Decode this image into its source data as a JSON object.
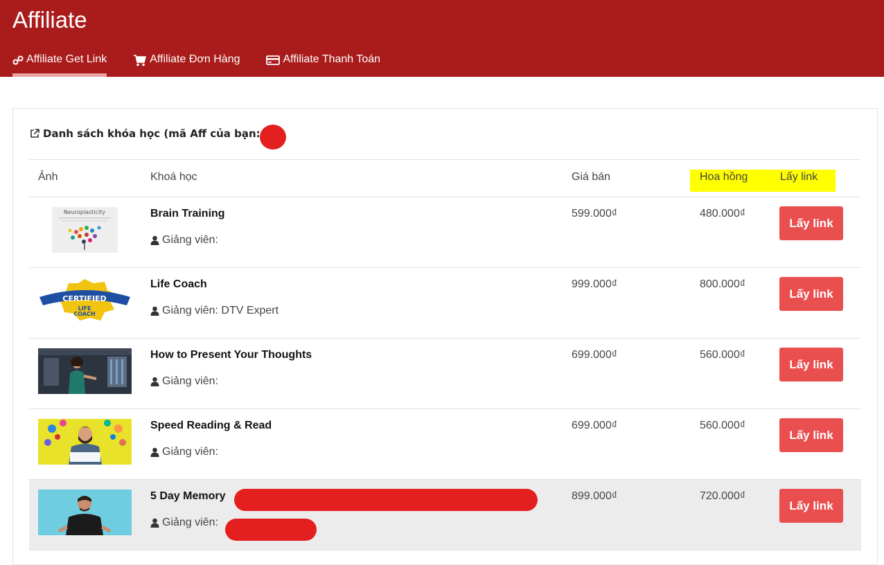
{
  "header": {
    "title": "Affiliate",
    "tabs": [
      {
        "label": "Affiliate Get Link",
        "icon": "link-icon",
        "active": true
      },
      {
        "label": "Affiliate Đơn Hàng",
        "icon": "cart-icon",
        "active": false
      },
      {
        "label": "Affiliate Thanh Toán",
        "icon": "credit-card-icon",
        "active": false
      }
    ]
  },
  "panel": {
    "heading": "Danh sách khóa học  (mã Aff của bạn:"
  },
  "table": {
    "columns": {
      "image": "Ảnh",
      "course": "Khoá học",
      "price": "Giá bán",
      "commission": "Hoa hồng",
      "get_link": "Lấy link"
    },
    "rows": [
      {
        "name": "Brain Training",
        "teacher": "Giảng viên:",
        "price": "599.000₫",
        "commission": "480.000₫",
        "button": "Lấy link",
        "thumb": "Neuroplasticity"
      },
      {
        "name": "Life Coach",
        "teacher": "Giảng viên: DTV Expert",
        "price": "999.000₫",
        "commission": "800.000₫",
        "button": "Lấy link",
        "thumb": "CERTIFIED LIFE COACH"
      },
      {
        "name": "How to Present Your Thoughts",
        "teacher": "Giảng viên:",
        "price": "699.000₫",
        "commission": "560.000₫",
        "button": "Lấy link",
        "thumb": ""
      },
      {
        "name": "Speed Reading & Read",
        "teacher": "Giảng viên:",
        "price": "699.000₫",
        "commission": "560.000₫",
        "button": "Lấy link",
        "thumb": ""
      },
      {
        "name": "5 Day Memory",
        "teacher": "Giảng viên:",
        "price": "899.000₫",
        "commission": "720.000₫",
        "button": "Lấy link",
        "thumb": ""
      }
    ]
  },
  "colors": {
    "header_bg": "#aa1c1c",
    "button_bg": "#ea4f4f",
    "highlight": "#ffff00",
    "redaction": "#e41f1f"
  }
}
